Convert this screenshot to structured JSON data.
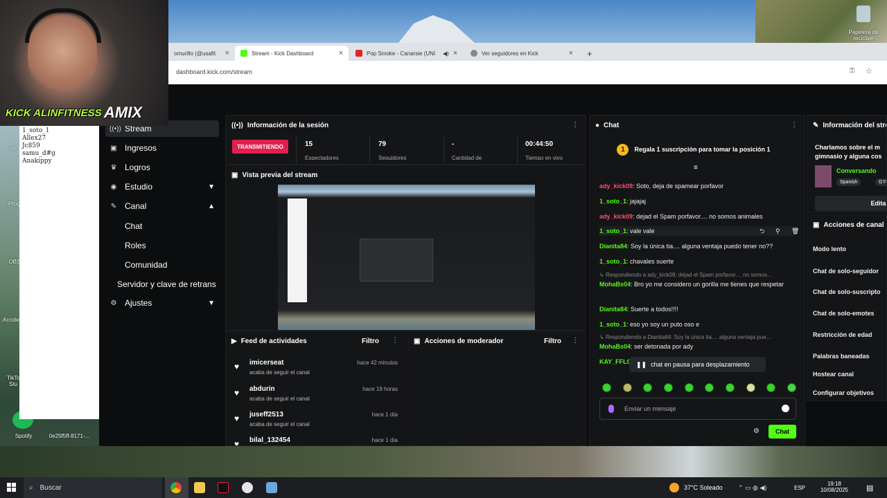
{
  "desktop": {
    "recycle_bin": "Papelera de reciclaje",
    "left_icons": [
      "Progr",
      "OBS",
      "Acrobat",
      "TikTok Stu",
      "Spotify"
    ],
    "file_icon": "0e25f5ff-8171-...",
    "left_labels": [
      "os"
    ]
  },
  "webcam": {
    "name": "KICK ALINFITNESS",
    "logo": "AMIX",
    "notes": [
      "1_soto_1",
      "Allex27",
      "Jc859",
      "samu_d#g",
      "Anakippy"
    ]
  },
  "browser": {
    "tabs": [
      {
        "label": "omurillo (@usafit",
        "active": false
      },
      {
        "label": "Stream - Kick Dashboard",
        "active": true
      },
      {
        "label": "Pop Smoke - Canarsie (UNI",
        "active": false
      },
      {
        "label": "Ver seguidores en Kick",
        "active": false
      }
    ],
    "new_tab": "+",
    "url": "dashboard.kick.com/stream"
  },
  "sidebar": {
    "items": [
      {
        "label": "Stream",
        "icon": "stream-icon"
      },
      {
        "label": "Ingresos",
        "icon": "money-icon"
      },
      {
        "label": "Logros",
        "icon": "trophy-icon"
      },
      {
        "label": "Estudio",
        "icon": "studio-icon"
      },
      {
        "label": "Canal",
        "icon": "channel-icon"
      },
      {
        "label": "Ajustes",
        "icon": "gear-icon"
      }
    ],
    "canal_sub": [
      "Chat",
      "Roles",
      "Comunidad",
      "Servidor y clave de retrans"
    ]
  },
  "session": {
    "title": "Información de la sesión",
    "live_badge": "TRANSMITIENDO",
    "stats": [
      {
        "value": "15",
        "label": "Espectadores"
      },
      {
        "value": "79",
        "label": "Seguidores"
      },
      {
        "value": "-",
        "label": "Cantidad de"
      },
      {
        "value": "00:44:50",
        "label": "Tiempo en vivo"
      }
    ]
  },
  "preview": {
    "title": "Vista previa del stream"
  },
  "feed": {
    "title": "Feed de actividades",
    "filter": "Filtro",
    "items": [
      {
        "name": "imicerseat",
        "time": "hace 42 minutos",
        "sub": "acaba de seguir el canal"
      },
      {
        "name": "abdurin",
        "time": "hace 19 horas",
        "sub": "acaba de seguir el canal"
      },
      {
        "name": "juseff2513",
        "time": "hace 1 día",
        "sub": "acaba de seguir el canal"
      },
      {
        "name": "bilal_132454",
        "time": "hace 1 día",
        "sub": ""
      }
    ]
  },
  "moderator": {
    "title": "Acciones de moderador",
    "filter": "Filtro"
  },
  "chat": {
    "title": "Chat",
    "pinned": "Regala 1 suscripción para tomar la posición 1",
    "pinned_rank": "1",
    "messages": [
      {
        "user": "ady_kick09",
        "color": "#ff4f6d",
        "text": "Soto, deja de spamear porfavor"
      },
      {
        "user": "1_soto_1",
        "color": "#53fc18",
        "text": "jajajaj"
      },
      {
        "user": "ady_kick09",
        "color": "#ff4f6d",
        "text": "dejad el Spam porfavor.... no somos animales"
      },
      {
        "user": "1_soto_1",
        "color": "#53fc18",
        "text": "vale vale"
      },
      {
        "user": "Dianita84",
        "color": "#53fc18",
        "text": "Soy la única tia.... alguna ventaja puedo tener no??"
      },
      {
        "user": "1_soto_1",
        "color": "#53fc18",
        "text": "chavales suerte"
      },
      {
        "user": "MohaBs04",
        "color": "#53fc18",
        "text": "Bro yo me considero un gorilla me tienes que respetar"
      },
      {
        "user": "Dianita84",
        "color": "#53fc18",
        "text": "Suerte a todos!!!!"
      },
      {
        "user": "1_soto_1",
        "color": "#53fc18",
        "text": "eso yo soy un puto oso e"
      },
      {
        "user": "MohaBs04",
        "color": "#53fc18",
        "text": "ser detonada por ady"
      },
      {
        "user": "KAY_FFLC",
        "color": "#53fc18",
        "text": ""
      }
    ],
    "replies": [
      "Respondiendo a ady_kick09: dejad el Spam porfavor.... no somos...",
      "Respondiendo a Dianita84: Soy la única tia.... alguna ventaja pue..."
    ],
    "paused": "chat en pausa para desplazamiento",
    "input_placeholder": "Enviar un mensaje",
    "send": "Chat"
  },
  "stream_info": {
    "title": "Información del stre",
    "desc": "Charlamos sobre el m gimnasio y alguna cos",
    "category": "Conversando",
    "tags": [
      "Spanish",
      "GYM"
    ],
    "edit": "Editar"
  },
  "channel_actions": {
    "title": "Acciones de canal",
    "items": [
      "Modo lento",
      "Chat de solo-seguidor",
      "Chat de solo-suscripto",
      "Chat de solo-emotes",
      "Restricción de edad",
      "Palabras baneadas",
      "Hostear canal",
      "Configurar objetivos"
    ]
  },
  "taskbar": {
    "search": "Buscar",
    "weather": "37°C  Soleado",
    "lang": "ESP",
    "time": "19:18",
    "date": "10/08/2025"
  },
  "colors": {
    "kick_green": "#53fc18",
    "live_red": "#e2204f",
    "panel": "#141517"
  }
}
